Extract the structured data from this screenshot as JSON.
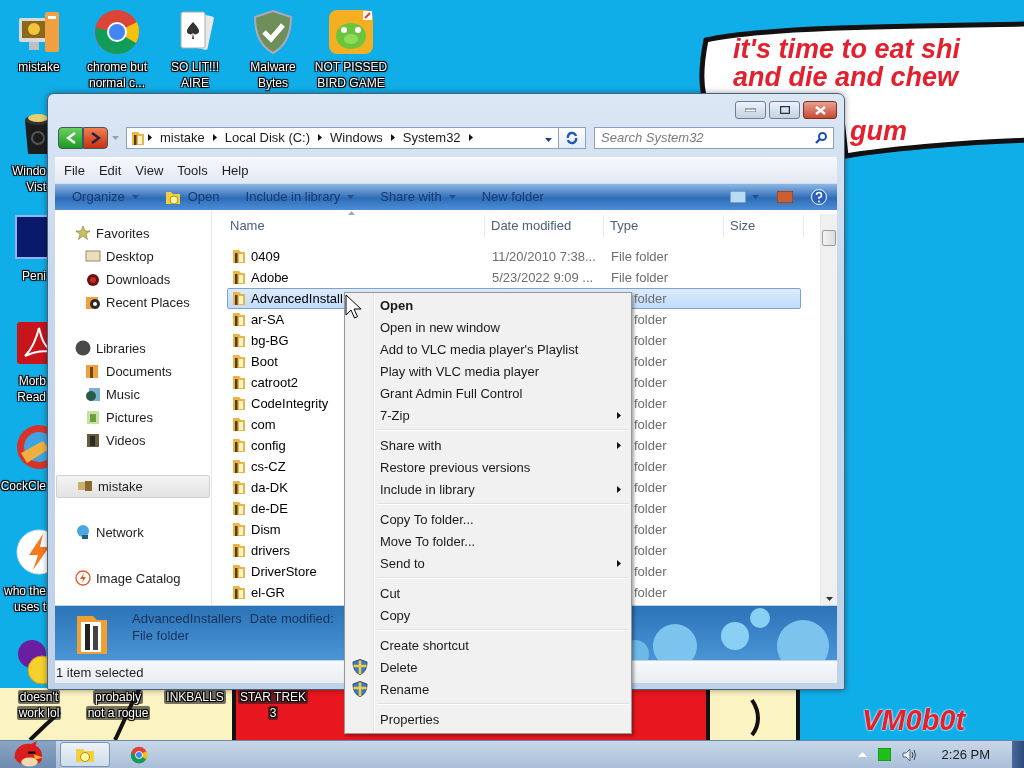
{
  "desktop": {
    "top_icons": [
      {
        "label": "mistake"
      },
      {
        "label": "chrome but\nnormal c..."
      },
      {
        "label": "SO LIT!!!\nAIRE"
      },
      {
        "label": "Malware\nBytes"
      },
      {
        "label": "NOT PISSED\nBIRD GAME"
      }
    ],
    "left_icons": [
      {
        "label": "Windo\nVist"
      },
      {
        "label": "Peni"
      },
      {
        "label": "Morb\nRead"
      },
      {
        "label": "CockCle"
      },
      {
        "label": "who the\nuses t"
      }
    ],
    "bottom_icons": [
      {
        "label": "doesn't\nwork lol"
      },
      {
        "label": "probably\nnot a rogue"
      },
      {
        "label": "INKBALLS"
      },
      {
        "label": "STAR TREK\n3"
      }
    ],
    "speech_lines": [
      "it's time to eat shi",
      "and die and chew",
      "gum"
    ],
    "signature": "VM0b0t"
  },
  "window": {
    "breadcrumbs": [
      "mistake",
      "Local Disk (C:)",
      "Windows",
      "System32"
    ],
    "search": {
      "placeholder": "Search System32"
    },
    "menu": [
      "File",
      "Edit",
      "View",
      "Tools",
      "Help"
    ],
    "commands": [
      {
        "label": "Organize",
        "dropdown": true
      },
      {
        "label": "Open",
        "dropdown": false
      },
      {
        "label": "Include in library",
        "dropdown": true
      },
      {
        "label": "Share with",
        "dropdown": true
      },
      {
        "label": "New folder",
        "dropdown": false
      }
    ],
    "nav": [
      {
        "label": "Favorites",
        "selected": false,
        "children": [
          {
            "label": "Desktop",
            "selected": false
          },
          {
            "label": "Downloads",
            "selected": false
          },
          {
            "label": "Recent Places",
            "selected": false
          }
        ]
      },
      {
        "label": "Libraries",
        "selected": false,
        "children": [
          {
            "label": "Documents",
            "selected": false
          },
          {
            "label": "Music",
            "selected": false
          },
          {
            "label": "Pictures",
            "selected": false
          },
          {
            "label": "Videos",
            "selected": false
          }
        ]
      },
      {
        "label": "mistake",
        "selected": true
      },
      {
        "label": "Network",
        "selected": false
      },
      {
        "label": "Image Catalog",
        "selected": false
      }
    ],
    "columns": [
      "Name",
      "Date modified",
      "Type",
      "Size"
    ],
    "rows": [
      {
        "name": "0409",
        "date": "11/20/2010 7:38...",
        "type": "File folder",
        "selected": false
      },
      {
        "name": "Adobe",
        "date": "5/23/2022 9:09 ...",
        "type": "File folder",
        "selected": false
      },
      {
        "name": "AdvancedInstall",
        "type": "folder",
        "selected": true
      },
      {
        "name": "ar-SA",
        "type": "folder",
        "selected": false
      },
      {
        "name": "bg-BG",
        "type": "folder",
        "selected": false
      },
      {
        "name": "Boot",
        "type": "folder",
        "selected": false
      },
      {
        "name": "catroot2",
        "type": "folder",
        "selected": false
      },
      {
        "name": "CodeIntegrity",
        "type": "folder",
        "selected": false
      },
      {
        "name": "com",
        "type": "folder",
        "selected": false
      },
      {
        "name": "config",
        "type": "folder",
        "selected": false
      },
      {
        "name": "cs-CZ",
        "type": "folder",
        "selected": false
      },
      {
        "name": "da-DK",
        "type": "folder",
        "selected": false
      },
      {
        "name": "de-DE",
        "type": "folder",
        "selected": false
      },
      {
        "name": "Dism",
        "type": "folder",
        "selected": false
      },
      {
        "name": "drivers",
        "type": "folder",
        "selected": false
      },
      {
        "name": "DriverStore",
        "type": "folder",
        "selected": false
      },
      {
        "name": "el-GR",
        "type": "folder",
        "selected": false
      }
    ],
    "details": {
      "name": "AdvancedInstallers",
      "date_label": "Date modified:",
      "type": "File folder"
    },
    "status": "1 item selected"
  },
  "context_menu": {
    "groups": [
      {
        "items": [
          {
            "label": "Open",
            "default": true,
            "submenu": false,
            "shield": false
          },
          {
            "label": "Open in new window",
            "default": false,
            "submenu": false,
            "shield": false
          },
          {
            "label": "Add to VLC media player's Playlist",
            "default": false,
            "submenu": false,
            "shield": false
          },
          {
            "label": "Play with VLC media player",
            "default": false,
            "submenu": false,
            "shield": false
          },
          {
            "label": "Grant Admin Full Control",
            "default": false,
            "submenu": false,
            "shield": false
          },
          {
            "label": "7-Zip",
            "default": false,
            "submenu": true,
            "shield": false
          }
        ]
      },
      {
        "items": [
          {
            "label": "Share with",
            "default": false,
            "submenu": true,
            "shield": false
          },
          {
            "label": "Restore previous versions",
            "default": false,
            "submenu": false,
            "shield": false
          },
          {
            "label": "Include in library",
            "default": false,
            "submenu": true,
            "shield": false
          }
        ]
      },
      {
        "items": [
          {
            "label": "Copy To folder...",
            "default": false,
            "submenu": false,
            "shield": false
          },
          {
            "label": "Move To folder...",
            "default": false,
            "submenu": false,
            "shield": false
          },
          {
            "label": "Send to",
            "default": false,
            "submenu": true,
            "shield": false
          }
        ]
      },
      {
        "items": [
          {
            "label": "Cut",
            "default": false,
            "submenu": false,
            "shield": false
          },
          {
            "label": "Copy",
            "default": false,
            "submenu": false,
            "shield": false
          }
        ]
      },
      {
        "items": [
          {
            "label": "Create shortcut",
            "default": false,
            "submenu": false,
            "shield": false
          },
          {
            "label": "Delete",
            "default": false,
            "submenu": false,
            "shield": true
          },
          {
            "label": "Rename",
            "default": false,
            "submenu": false,
            "shield": true
          }
        ]
      },
      {
        "items": [
          {
            "label": "Properties",
            "default": false,
            "submenu": false,
            "shield": false
          }
        ]
      }
    ]
  },
  "taskbar": {
    "tasks": [
      {
        "selected": true
      },
      {
        "selected": false
      }
    ],
    "clock": "2:26 PM"
  }
}
